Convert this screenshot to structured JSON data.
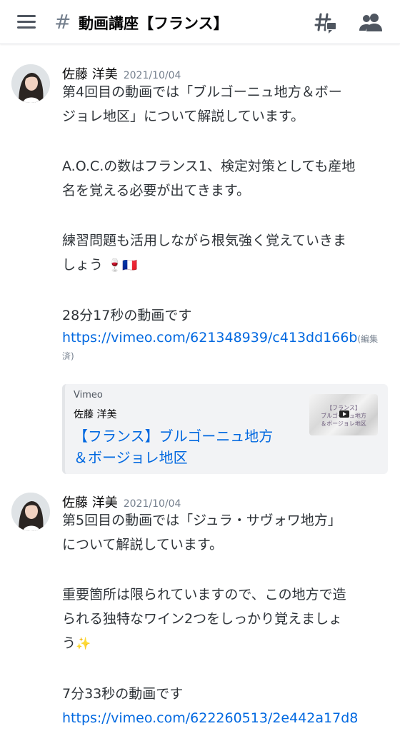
{
  "header": {
    "channel_name": "動画講座【フランス】"
  },
  "messages": [
    {
      "author": "佐藤 洋美",
      "timestamp": "2021/10/04",
      "lines": [
        "第4回目の動画では「ブルゴーニュ地方＆ボー",
        "ジョレ地区」について解説しています。",
        "A.O.C.の数はフランス1、検定対策としても産地",
        "名を覚える必要が出てきます。",
        "練習問題も活用しながら根気強く覚えていきま",
        "しょう",
        "28分17秒の動画です"
      ],
      "emoji": [
        "🍷",
        "🇫🇷"
      ],
      "link": "https://vimeo.com/621348939/c413dd166b",
      "edited_1": "(編集",
      "edited_2": "済)",
      "embed": {
        "provider": "Vimeo",
        "author": "佐藤 洋美",
        "title_1": "【フランス】ブルゴーニュ地方",
        "title_2": "＆ボージョレ地区",
        "thumb_1": "【フランス】",
        "thumb_2": "ブルゴーニュ地方",
        "thumb_3": "＆ボージョレ地区"
      }
    },
    {
      "author": "佐藤 洋美",
      "timestamp": "2021/10/04",
      "lines": [
        "第5回目の動画では「ジュラ・サヴォワ地方」",
        "について解説しています。",
        "重要箇所は限られていますので、この地方で造",
        "られる独特なワイン2つをしっかり覚えましょ",
        "う",
        "7分33秒の動画です"
      ],
      "emoji": [
        "✨"
      ],
      "link": "https://vimeo.com/622260513/2e442a17d8"
    }
  ]
}
